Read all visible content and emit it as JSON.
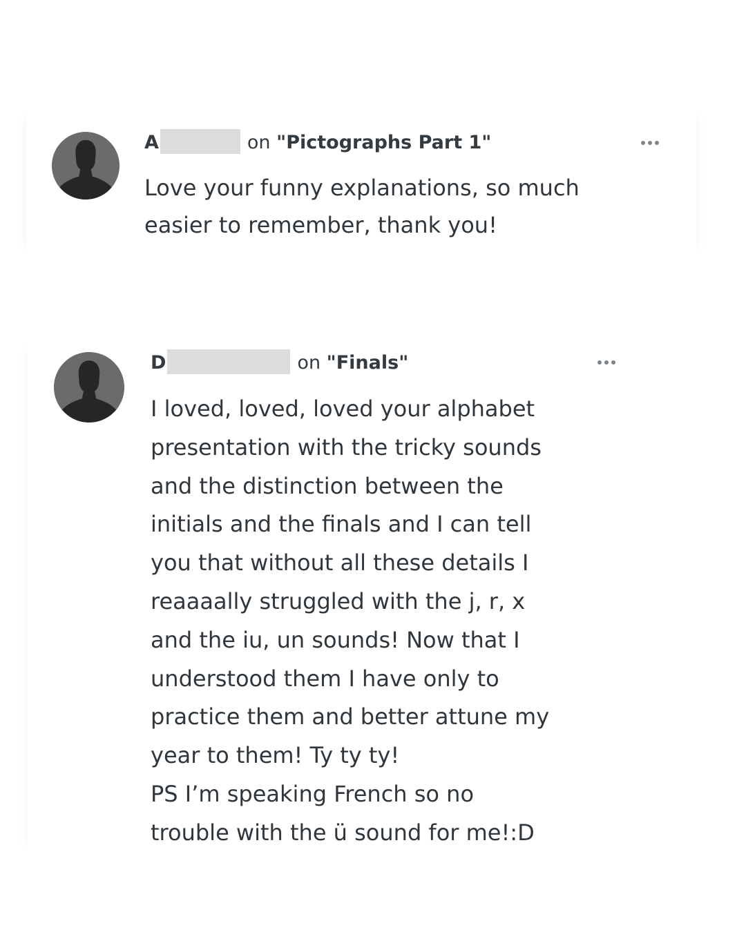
{
  "comments": [
    {
      "author_initial": "A",
      "on_label": "on",
      "post_title": "\"Pictographs Part 1\"",
      "text": "Love your funny explanations, so much\neasier to remember, thank you!",
      "menu_icon": "more-horizontal-icon",
      "avatar_icon": "default-user-avatar-icon"
    },
    {
      "author_initial": "D",
      "on_label": "on",
      "post_title": "\"Finals\"",
      "text": "I loved, loved, loved your alphabet\npresentation with the tricky sounds\nand the distinction between the\ninitials and the finals and I can tell\nyou that without all these details I\nreaaaally struggled with the j, r, x\nand the iu, un sounds! Now that I\nunderstood them I have only to\npractice them and better attune my\nyear to them! Ty ty ty!\nPS I’m speaking French so no\ntrouble with the ü sound for me!:D",
      "menu_icon": "more-horizontal-icon",
      "avatar_icon": "default-user-avatar-icon"
    }
  ],
  "colors": {
    "text": "#333a40",
    "avatar_bg": "#6b6b6b",
    "avatar_figure": "#262626",
    "redaction": "#dcdcdc",
    "menu_dots": "#7d848a"
  }
}
